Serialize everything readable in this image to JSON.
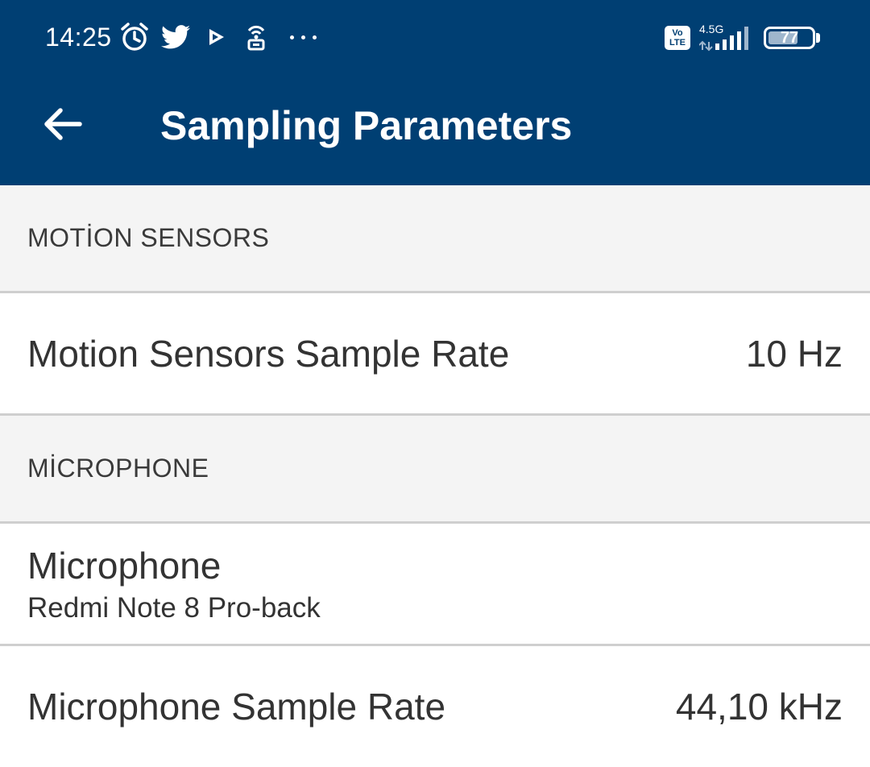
{
  "status_bar": {
    "time": "14:25",
    "network_type": "4.5G",
    "volte_top": "Vo",
    "volte_bottom": "LTE",
    "battery_level": "77",
    "icons": [
      "alarm-icon",
      "twitter-icon",
      "play-store-icon",
      "hotspot-icon",
      "more-notifications-icon",
      "volte-icon",
      "signal-icon",
      "battery-icon"
    ]
  },
  "app_bar": {
    "title": "Sampling Parameters",
    "back_icon": "arrow-back-icon",
    "background_color": "#003f73"
  },
  "sections": [
    {
      "header": "MOTİON SENSORS",
      "rows": [
        {
          "title": "Motion Sensors Sample Rate",
          "value": "10 Hz"
        }
      ]
    },
    {
      "header": "MİCROPHONE",
      "rows": [
        {
          "title": "Microphone",
          "subtitle": "Redmi Note 8 Pro-back"
        },
        {
          "title": "Microphone Sample Rate",
          "value": "44,10 kHz"
        }
      ]
    }
  ]
}
